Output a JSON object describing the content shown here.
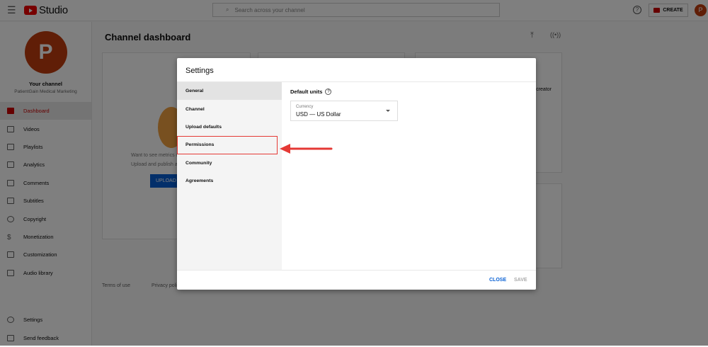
{
  "header": {
    "app_title": "Studio",
    "search_placeholder": "Search across your channel",
    "create_label": "CREATE",
    "avatar_letter": "P",
    "help": "?"
  },
  "sidebar": {
    "avatar_letter": "P",
    "your_channel": "Your channel",
    "channel_name": "PatientGain Medical Marketing",
    "items": [
      {
        "label": "Dashboard",
        "active": true
      },
      {
        "label": "Videos"
      },
      {
        "label": "Playlists"
      },
      {
        "label": "Analytics"
      },
      {
        "label": "Comments"
      },
      {
        "label": "Subtitles"
      },
      {
        "label": "Copyright"
      },
      {
        "label": "Monetization"
      },
      {
        "label": "Customization"
      },
      {
        "label": "Audio library"
      }
    ],
    "bottom": [
      {
        "label": "Settings"
      },
      {
        "label": "Send feedback"
      }
    ]
  },
  "main": {
    "title": "Channel dashboard",
    "card_text_1": "Want to see metrics o",
    "card_text_2": "Upload and publish a",
    "upload_label": "UPLOAD",
    "creator_text": "creator",
    "footer": [
      "Terms of use",
      "Privacy poli"
    ]
  },
  "dialog": {
    "title": "Settings",
    "nav": [
      "General",
      "Channel",
      "Upload defaults",
      "Permissions",
      "Community",
      "Agreements"
    ],
    "section_title": "Default units",
    "currency_label": "Currency",
    "currency_value": "USD — US Dollar",
    "close_label": "CLOSE",
    "save_label": "SAVE"
  },
  "colors": {
    "accent": "#065fd4",
    "highlight": "#e53935",
    "brand": "#ff0000"
  }
}
